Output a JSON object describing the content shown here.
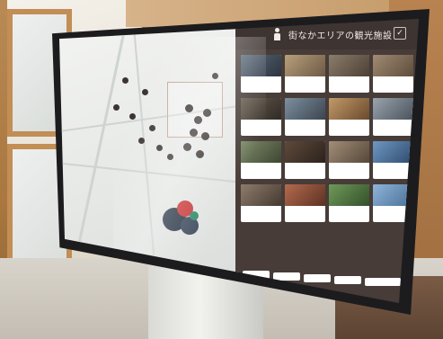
{
  "panel": {
    "title": "街なかエリアの観光施設",
    "close_label": "✓"
  },
  "cards": [
    {
      "num": "",
      "title": "",
      "link": ""
    },
    {
      "num": "",
      "title": "",
      "link": ""
    },
    {
      "num": "",
      "title": "",
      "link": ""
    },
    {
      "num": "",
      "title": "",
      "link": ""
    },
    {
      "num": "",
      "title": "",
      "link": ""
    },
    {
      "num": "",
      "title": "",
      "link": ""
    },
    {
      "num": "",
      "title": "",
      "link": ""
    },
    {
      "num": "",
      "title": "",
      "link": ""
    },
    {
      "num": "",
      "title": "",
      "link": ""
    },
    {
      "num": "",
      "title": "",
      "link": ""
    },
    {
      "num": "",
      "title": "",
      "link": ""
    },
    {
      "num": "",
      "title": "",
      "link": ""
    },
    {
      "num": "",
      "title": "",
      "link": ""
    },
    {
      "num": "",
      "title": "",
      "link": ""
    },
    {
      "num": "",
      "title": "",
      "link": ""
    },
    {
      "num": "",
      "title": "",
      "link": ""
    }
  ],
  "tabs": [
    "",
    "",
    "",
    "",
    ""
  ],
  "colors": {
    "panel_bg": "#473c38",
    "header_bg": "#3e3431",
    "link": "#3a73c5",
    "map_bg": "#eceeec"
  }
}
